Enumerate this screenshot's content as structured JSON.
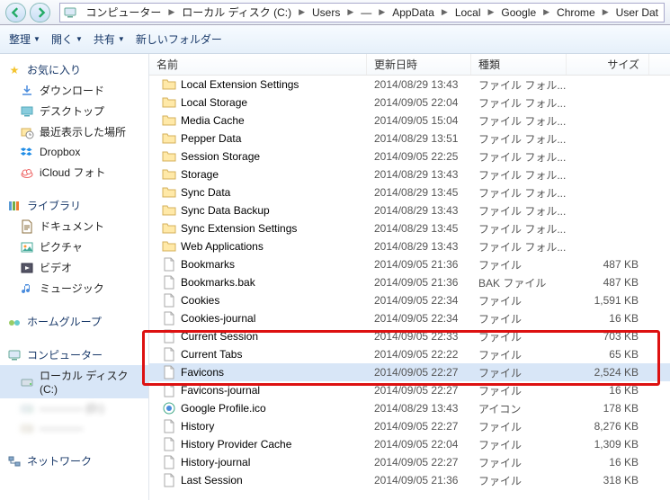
{
  "titlebar": {
    "crumbs": [
      "コンピューター",
      "ローカル ディスク (C:)",
      "Users",
      "—",
      "AppData",
      "Local",
      "Google",
      "Chrome",
      "User Dat"
    ]
  },
  "toolbar": {
    "organize": "整理",
    "open": "開く",
    "share": "共有",
    "newfolder": "新しいフォルダー"
  },
  "sidebar": {
    "fav_head": "お気に入り",
    "fav": [
      {
        "label": "ダウンロード",
        "icon": "download"
      },
      {
        "label": "デスクトップ",
        "icon": "desktop"
      },
      {
        "label": "最近表示した場所",
        "icon": "recent"
      },
      {
        "label": "Dropbox",
        "icon": "dropbox"
      },
      {
        "label": "iCloud フォト",
        "icon": "icloud"
      }
    ],
    "lib_head": "ライブラリ",
    "lib": [
      {
        "label": "ドキュメント",
        "icon": "doc"
      },
      {
        "label": "ピクチャ",
        "icon": "pic"
      },
      {
        "label": "ビデオ",
        "icon": "vid"
      },
      {
        "label": "ミュージック",
        "icon": "mus"
      }
    ],
    "home_head": "ホームグループ",
    "comp_head": "コンピューター",
    "drives": [
      {
        "label": "ローカル ディスク (C:)",
        "icon": "hdd",
        "sel": true
      },
      {
        "label": "———— (D:)",
        "icon": "hdd",
        "blur": true
      },
      {
        "label": "————",
        "icon": "drive",
        "blur": true
      }
    ],
    "net_head": "ネットワーク"
  },
  "columns": {
    "name": "名前",
    "date": "更新日時",
    "type": "種類",
    "size": "サイズ"
  },
  "files": [
    {
      "n": "Local Extension Settings",
      "d": "2014/08/29 13:43",
      "t": "ファイル フォル...",
      "s": "",
      "i": "folder"
    },
    {
      "n": "Local Storage",
      "d": "2014/09/05 22:04",
      "t": "ファイル フォル...",
      "s": "",
      "i": "folder"
    },
    {
      "n": "Media Cache",
      "d": "2014/09/05 15:04",
      "t": "ファイル フォル...",
      "s": "",
      "i": "folder"
    },
    {
      "n": "Pepper Data",
      "d": "2014/08/29 13:51",
      "t": "ファイル フォル...",
      "s": "",
      "i": "folder"
    },
    {
      "n": "Session Storage",
      "d": "2014/09/05 22:25",
      "t": "ファイル フォル...",
      "s": "",
      "i": "folder"
    },
    {
      "n": "Storage",
      "d": "2014/08/29 13:43",
      "t": "ファイル フォル...",
      "s": "",
      "i": "folder"
    },
    {
      "n": "Sync Data",
      "d": "2014/08/29 13:45",
      "t": "ファイル フォル...",
      "s": "",
      "i": "folder"
    },
    {
      "n": "Sync Data Backup",
      "d": "2014/08/29 13:43",
      "t": "ファイル フォル...",
      "s": "",
      "i": "folder"
    },
    {
      "n": "Sync Extension Settings",
      "d": "2014/08/29 13:45",
      "t": "ファイル フォル...",
      "s": "",
      "i": "folder"
    },
    {
      "n": "Web Applications",
      "d": "2014/08/29 13:43",
      "t": "ファイル フォル...",
      "s": "",
      "i": "folder"
    },
    {
      "n": "Bookmarks",
      "d": "2014/09/05 21:36",
      "t": "ファイル",
      "s": "487 KB",
      "i": "file"
    },
    {
      "n": "Bookmarks.bak",
      "d": "2014/09/05 21:36",
      "t": "BAK ファイル",
      "s": "487 KB",
      "i": "file"
    },
    {
      "n": "Cookies",
      "d": "2014/09/05 22:34",
      "t": "ファイル",
      "s": "1,591 KB",
      "i": "file"
    },
    {
      "n": "Cookies-journal",
      "d": "2014/09/05 22:34",
      "t": "ファイル",
      "s": "16 KB",
      "i": "file"
    },
    {
      "n": "Current Session",
      "d": "2014/09/05 22:33",
      "t": "ファイル",
      "s": "703 KB",
      "i": "file"
    },
    {
      "n": "Current Tabs",
      "d": "2014/09/05 22:22",
      "t": "ファイル",
      "s": "65 KB",
      "i": "file"
    },
    {
      "n": "Favicons",
      "d": "2014/09/05 22:27",
      "t": "ファイル",
      "s": "2,524 KB",
      "i": "file",
      "sel": true
    },
    {
      "n": "Favicons-journal",
      "d": "2014/09/05 22:27",
      "t": "ファイル",
      "s": "16 KB",
      "i": "file"
    },
    {
      "n": "Google Profile.ico",
      "d": "2014/08/29 13:43",
      "t": "アイコン",
      "s": "178 KB",
      "i": "ico"
    },
    {
      "n": "History",
      "d": "2014/09/05 22:27",
      "t": "ファイル",
      "s": "8,276 KB",
      "i": "file"
    },
    {
      "n": "History Provider Cache",
      "d": "2014/09/05 22:04",
      "t": "ファイル",
      "s": "1,309 KB",
      "i": "file"
    },
    {
      "n": "History-journal",
      "d": "2014/09/05 22:27",
      "t": "ファイル",
      "s": "16 KB",
      "i": "file"
    },
    {
      "n": "Last Session",
      "d": "2014/09/05 21:36",
      "t": "ファイル",
      "s": "318 KB",
      "i": "file"
    }
  ]
}
